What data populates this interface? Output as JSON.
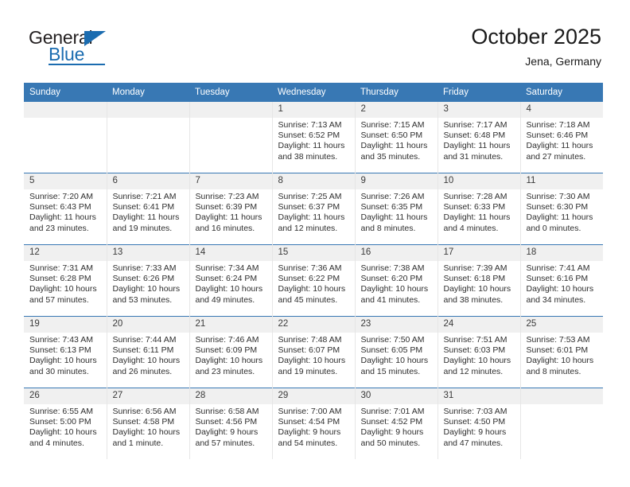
{
  "brand": {
    "name_top": "General",
    "name_bottom": "Blue"
  },
  "header": {
    "title": "October 2025",
    "location": "Jena, Germany"
  },
  "calendar": {
    "weekday_headers": [
      "Sunday",
      "Monday",
      "Tuesday",
      "Wednesday",
      "Thursday",
      "Friday",
      "Saturday"
    ],
    "accent_color": "#3878b4",
    "daynum_band_color": "#f0f0f0",
    "weeks": [
      [
        {
          "day": "",
          "lines": [],
          "empty": true
        },
        {
          "day": "",
          "lines": [],
          "empty": true
        },
        {
          "day": "",
          "lines": [],
          "empty": true
        },
        {
          "day": "1",
          "lines": [
            "Sunrise: 7:13 AM",
            "Sunset: 6:52 PM",
            "Daylight: 11 hours",
            "and 38 minutes."
          ],
          "empty": false
        },
        {
          "day": "2",
          "lines": [
            "Sunrise: 7:15 AM",
            "Sunset: 6:50 PM",
            "Daylight: 11 hours",
            "and 35 minutes."
          ],
          "empty": false
        },
        {
          "day": "3",
          "lines": [
            "Sunrise: 7:17 AM",
            "Sunset: 6:48 PM",
            "Daylight: 11 hours",
            "and 31 minutes."
          ],
          "empty": false
        },
        {
          "day": "4",
          "lines": [
            "Sunrise: 7:18 AM",
            "Sunset: 6:46 PM",
            "Daylight: 11 hours",
            "and 27 minutes."
          ],
          "empty": false
        }
      ],
      [
        {
          "day": "5",
          "lines": [
            "Sunrise: 7:20 AM",
            "Sunset: 6:43 PM",
            "Daylight: 11 hours",
            "and 23 minutes."
          ],
          "empty": false
        },
        {
          "day": "6",
          "lines": [
            "Sunrise: 7:21 AM",
            "Sunset: 6:41 PM",
            "Daylight: 11 hours",
            "and 19 minutes."
          ],
          "empty": false
        },
        {
          "day": "7",
          "lines": [
            "Sunrise: 7:23 AM",
            "Sunset: 6:39 PM",
            "Daylight: 11 hours",
            "and 16 minutes."
          ],
          "empty": false
        },
        {
          "day": "8",
          "lines": [
            "Sunrise: 7:25 AM",
            "Sunset: 6:37 PM",
            "Daylight: 11 hours",
            "and 12 minutes."
          ],
          "empty": false
        },
        {
          "day": "9",
          "lines": [
            "Sunrise: 7:26 AM",
            "Sunset: 6:35 PM",
            "Daylight: 11 hours",
            "and 8 minutes."
          ],
          "empty": false
        },
        {
          "day": "10",
          "lines": [
            "Sunrise: 7:28 AM",
            "Sunset: 6:33 PM",
            "Daylight: 11 hours",
            "and 4 minutes."
          ],
          "empty": false
        },
        {
          "day": "11",
          "lines": [
            "Sunrise: 7:30 AM",
            "Sunset: 6:30 PM",
            "Daylight: 11 hours",
            "and 0 minutes."
          ],
          "empty": false
        }
      ],
      [
        {
          "day": "12",
          "lines": [
            "Sunrise: 7:31 AM",
            "Sunset: 6:28 PM",
            "Daylight: 10 hours",
            "and 57 minutes."
          ],
          "empty": false
        },
        {
          "day": "13",
          "lines": [
            "Sunrise: 7:33 AM",
            "Sunset: 6:26 PM",
            "Daylight: 10 hours",
            "and 53 minutes."
          ],
          "empty": false
        },
        {
          "day": "14",
          "lines": [
            "Sunrise: 7:34 AM",
            "Sunset: 6:24 PM",
            "Daylight: 10 hours",
            "and 49 minutes."
          ],
          "empty": false
        },
        {
          "day": "15",
          "lines": [
            "Sunrise: 7:36 AM",
            "Sunset: 6:22 PM",
            "Daylight: 10 hours",
            "and 45 minutes."
          ],
          "empty": false
        },
        {
          "day": "16",
          "lines": [
            "Sunrise: 7:38 AM",
            "Sunset: 6:20 PM",
            "Daylight: 10 hours",
            "and 41 minutes."
          ],
          "empty": false
        },
        {
          "day": "17",
          "lines": [
            "Sunrise: 7:39 AM",
            "Sunset: 6:18 PM",
            "Daylight: 10 hours",
            "and 38 minutes."
          ],
          "empty": false
        },
        {
          "day": "18",
          "lines": [
            "Sunrise: 7:41 AM",
            "Sunset: 6:16 PM",
            "Daylight: 10 hours",
            "and 34 minutes."
          ],
          "empty": false
        }
      ],
      [
        {
          "day": "19",
          "lines": [
            "Sunrise: 7:43 AM",
            "Sunset: 6:13 PM",
            "Daylight: 10 hours",
            "and 30 minutes."
          ],
          "empty": false
        },
        {
          "day": "20",
          "lines": [
            "Sunrise: 7:44 AM",
            "Sunset: 6:11 PM",
            "Daylight: 10 hours",
            "and 26 minutes."
          ],
          "empty": false
        },
        {
          "day": "21",
          "lines": [
            "Sunrise: 7:46 AM",
            "Sunset: 6:09 PM",
            "Daylight: 10 hours",
            "and 23 minutes."
          ],
          "empty": false
        },
        {
          "day": "22",
          "lines": [
            "Sunrise: 7:48 AM",
            "Sunset: 6:07 PM",
            "Daylight: 10 hours",
            "and 19 minutes."
          ],
          "empty": false
        },
        {
          "day": "23",
          "lines": [
            "Sunrise: 7:50 AM",
            "Sunset: 6:05 PM",
            "Daylight: 10 hours",
            "and 15 minutes."
          ],
          "empty": false
        },
        {
          "day": "24",
          "lines": [
            "Sunrise: 7:51 AM",
            "Sunset: 6:03 PM",
            "Daylight: 10 hours",
            "and 12 minutes."
          ],
          "empty": false
        },
        {
          "day": "25",
          "lines": [
            "Sunrise: 7:53 AM",
            "Sunset: 6:01 PM",
            "Daylight: 10 hours",
            "and 8 minutes."
          ],
          "empty": false
        }
      ],
      [
        {
          "day": "26",
          "lines": [
            "Sunrise: 6:55 AM",
            "Sunset: 5:00 PM",
            "Daylight: 10 hours",
            "and 4 minutes."
          ],
          "empty": false
        },
        {
          "day": "27",
          "lines": [
            "Sunrise: 6:56 AM",
            "Sunset: 4:58 PM",
            "Daylight: 10 hours",
            "and 1 minute."
          ],
          "empty": false
        },
        {
          "day": "28",
          "lines": [
            "Sunrise: 6:58 AM",
            "Sunset: 4:56 PM",
            "Daylight: 9 hours",
            "and 57 minutes."
          ],
          "empty": false
        },
        {
          "day": "29",
          "lines": [
            "Sunrise: 7:00 AM",
            "Sunset: 4:54 PM",
            "Daylight: 9 hours",
            "and 54 minutes."
          ],
          "empty": false
        },
        {
          "day": "30",
          "lines": [
            "Sunrise: 7:01 AM",
            "Sunset: 4:52 PM",
            "Daylight: 9 hours",
            "and 50 minutes."
          ],
          "empty": false
        },
        {
          "day": "31",
          "lines": [
            "Sunrise: 7:03 AM",
            "Sunset: 4:50 PM",
            "Daylight: 9 hours",
            "and 47 minutes."
          ],
          "empty": false
        },
        {
          "day": "",
          "lines": [],
          "empty": true
        }
      ]
    ]
  }
}
